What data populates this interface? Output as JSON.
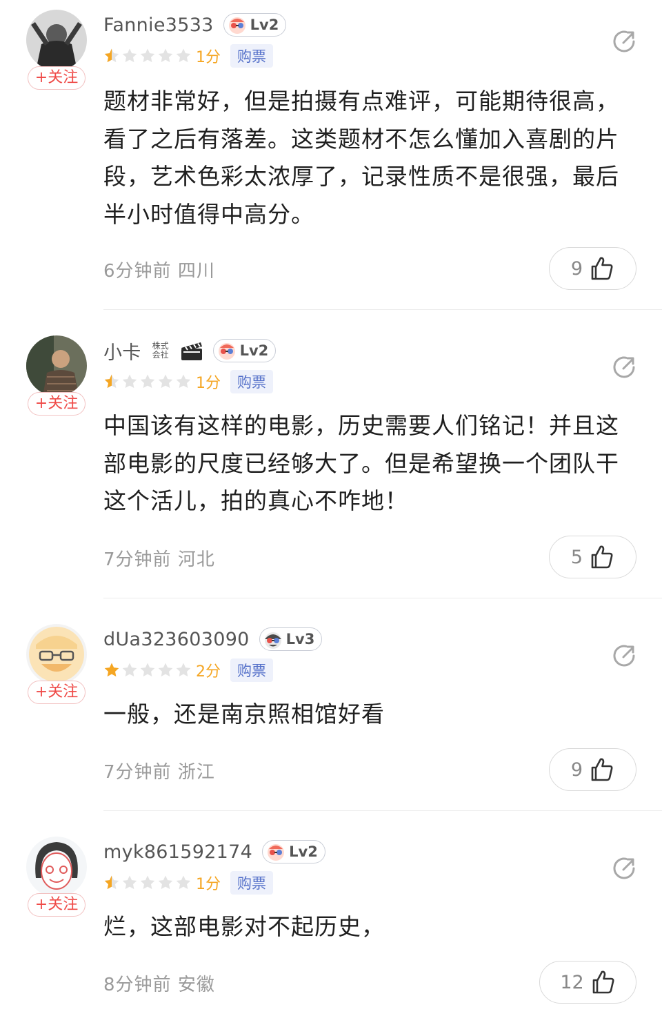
{
  "comments": [
    {
      "username": "Fannie3533",
      "level": "Lv2",
      "follow_label": "+关注",
      "stars_filled": 0.5,
      "score": "1分",
      "ticket": "购票",
      "text": "题材非常好，但是拍摄有点难评，可能期待很高，看了之后有落差。这类题材不怎么懂加入喜剧的片段，艺术色彩太浓厚了，记录性质不是很强，最后半小时值得中高分。",
      "time": "6分钟前",
      "location": "四川",
      "likes": "9"
    },
    {
      "username": "小卡",
      "company_tag": "株式会社",
      "level": "Lv2",
      "follow_label": "+关注",
      "stars_filled": 0.5,
      "score": "1分",
      "ticket": "购票",
      "text": "中国该有这样的电影，历史需要人们铭记！并且这部电影的尺度已经够大了。但是希望换一个团队干这个活儿，拍的真心不咋地！",
      "time": "7分钟前",
      "location": "河北",
      "likes": "5"
    },
    {
      "username": "dUa323603090",
      "level": "Lv3",
      "follow_label": "+关注",
      "stars_filled": 1,
      "score": "2分",
      "ticket": "购票",
      "text": "一般，还是南京照相馆好看",
      "time": "7分钟前",
      "location": "浙江",
      "likes": "9"
    },
    {
      "username": "myk861592174",
      "level": "Lv2",
      "follow_label": "+关注",
      "stars_filled": 0.5,
      "score": "1分",
      "ticket": "购票",
      "text": "烂，这部电影对不起历史，",
      "time": "8分钟前",
      "location": "安徽",
      "likes": "12"
    }
  ],
  "colors": {
    "star_filled": "#f5a623",
    "star_empty": "#e3e3e3",
    "follow_red": "#ef4a47",
    "ticket_blue": "#5470c9"
  }
}
